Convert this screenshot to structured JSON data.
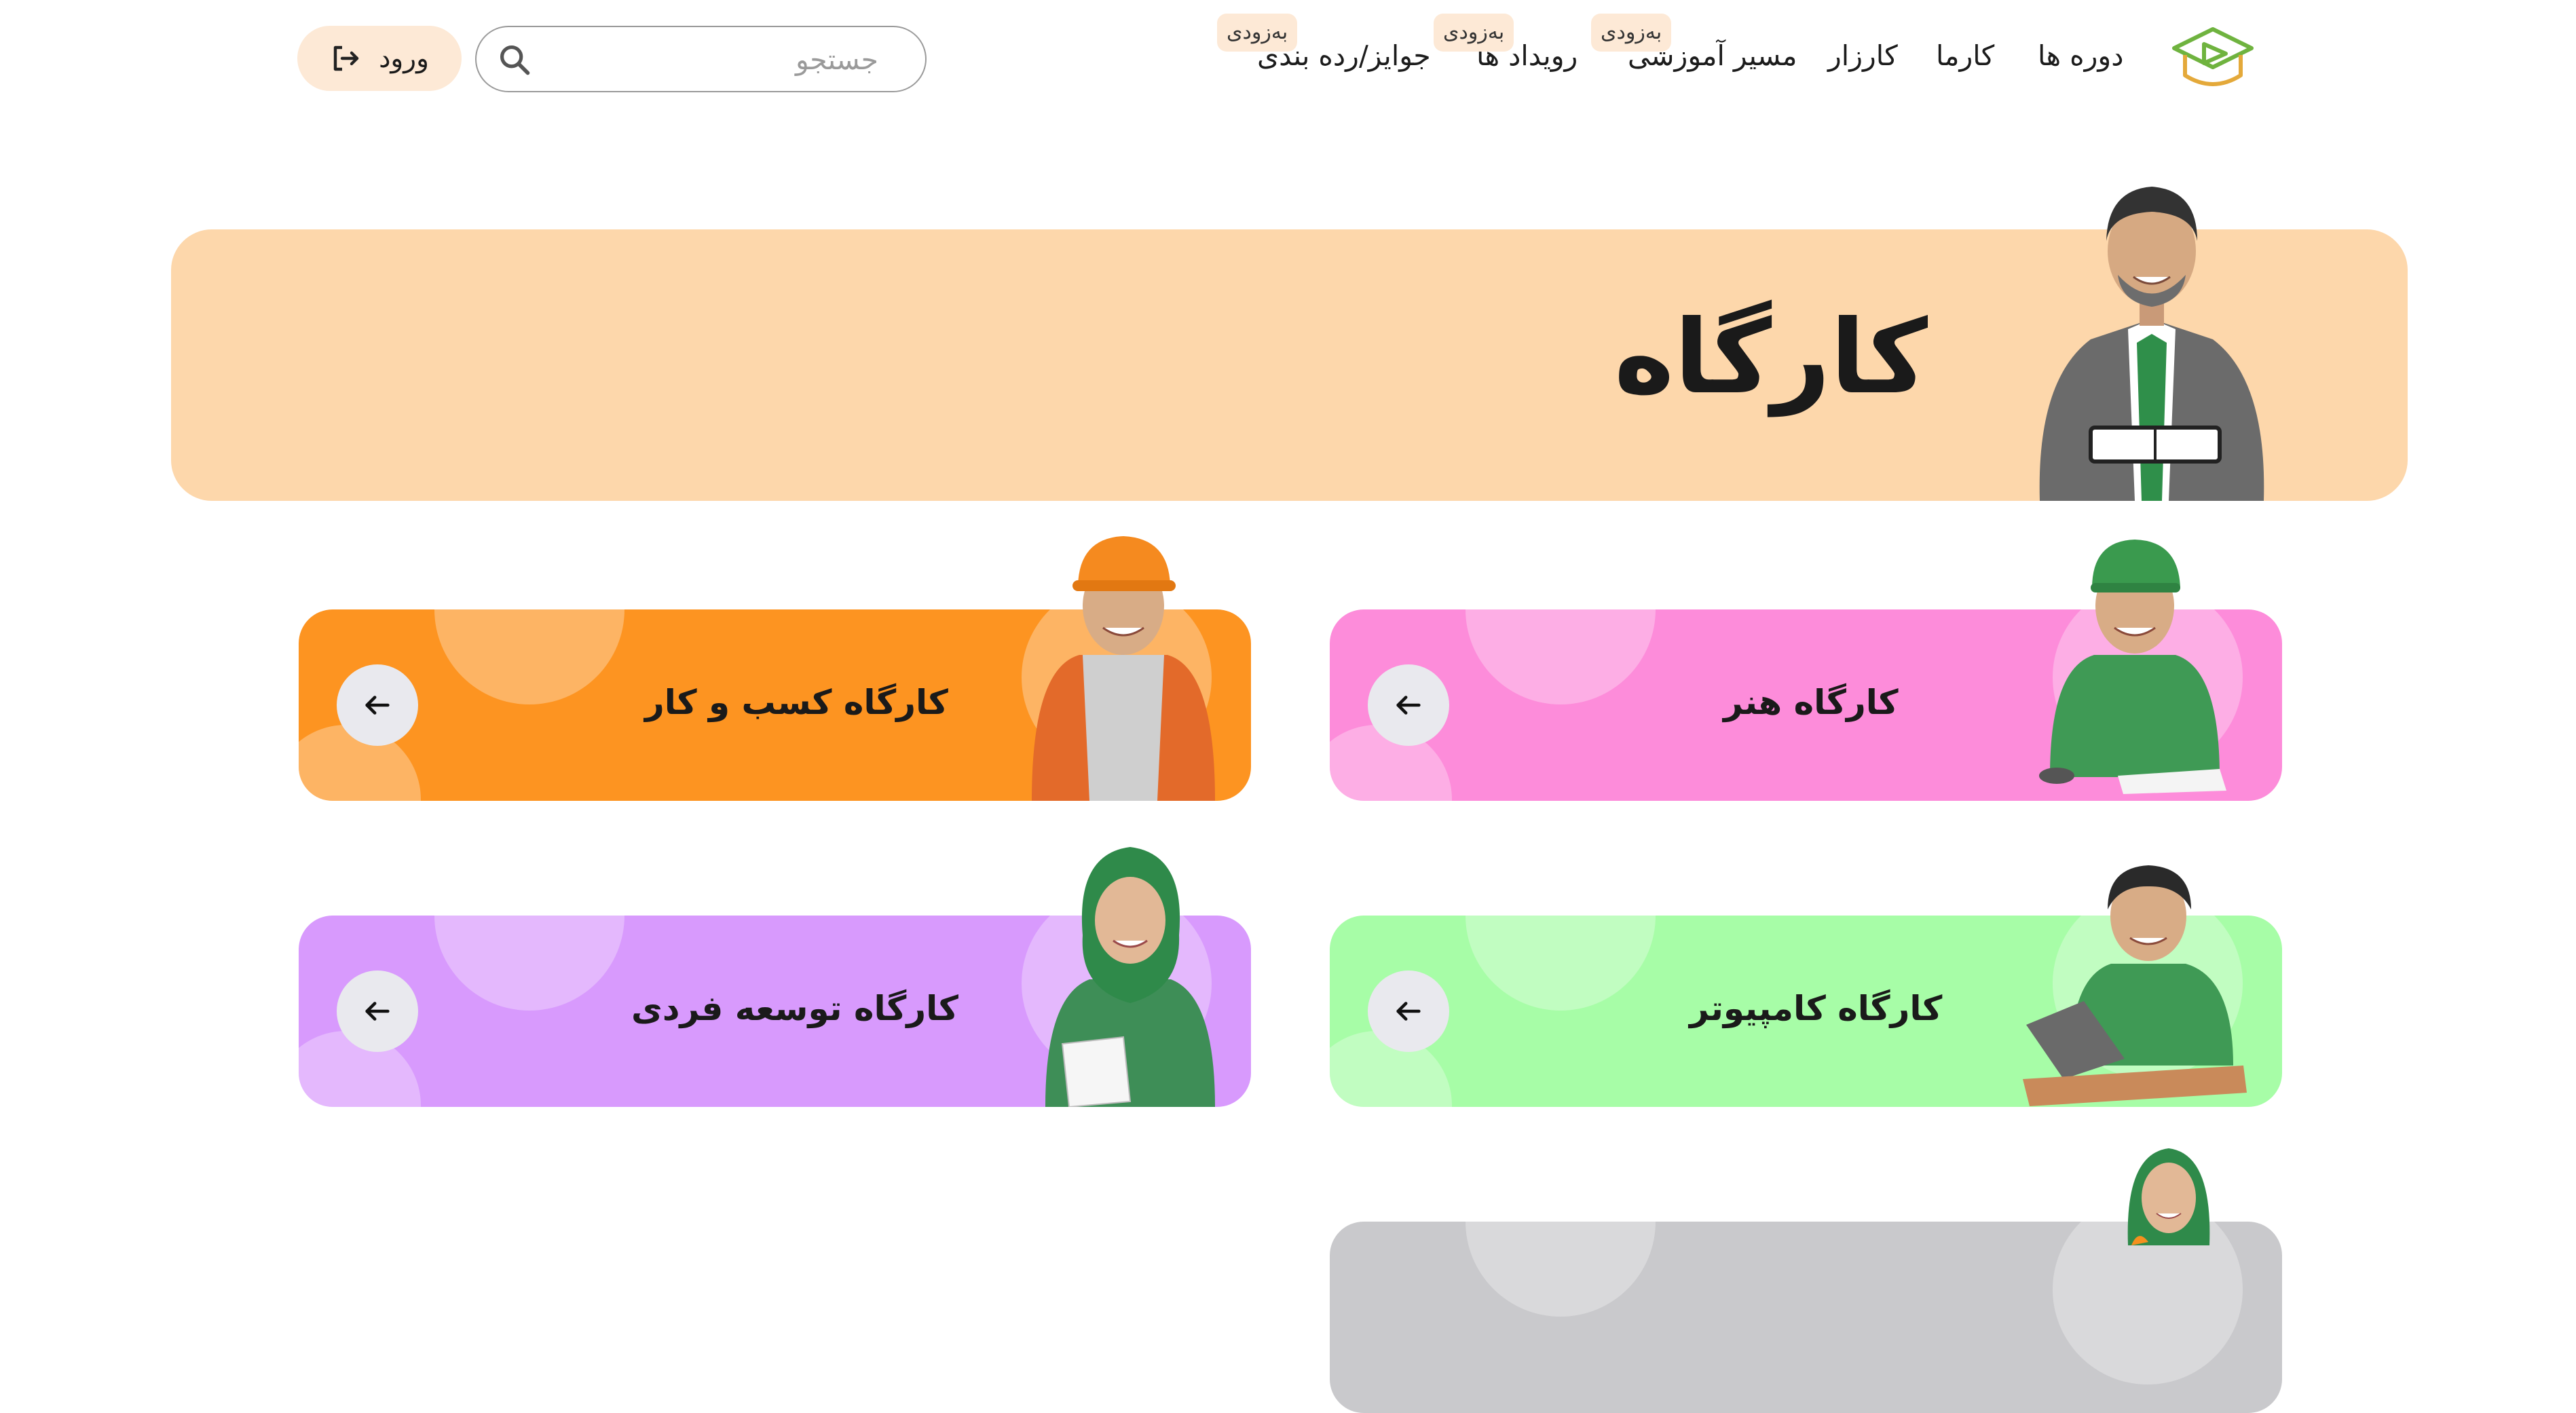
{
  "nav": {
    "items": [
      "دوره ها",
      "کارما",
      "کارزار",
      "مسیر آموزشی",
      "رویداد ها",
      "جوایز/رده بندی"
    ],
    "soon_badge": "به‌زودی"
  },
  "search": {
    "placeholder": "جستجو"
  },
  "login": {
    "label": "ورود"
  },
  "hero": {
    "title": "کارگاه"
  },
  "cards": [
    {
      "title": "کارگاه کسب و کار",
      "color": "#fd9421"
    },
    {
      "title": "کارگاه هنر",
      "color": "#fd8cda"
    },
    {
      "title": "کارگاه توسعه فردی",
      "color": "#d89afd"
    },
    {
      "title": "کارگاه کامپیوتر",
      "color": "#a7fda7"
    },
    {
      "title": "",
      "color": "#c9c9cc"
    }
  ],
  "icons": {
    "logo": "graduation-play-logo",
    "search": "search-icon",
    "login": "login-icon",
    "arrow": "arrow-left-icon"
  }
}
